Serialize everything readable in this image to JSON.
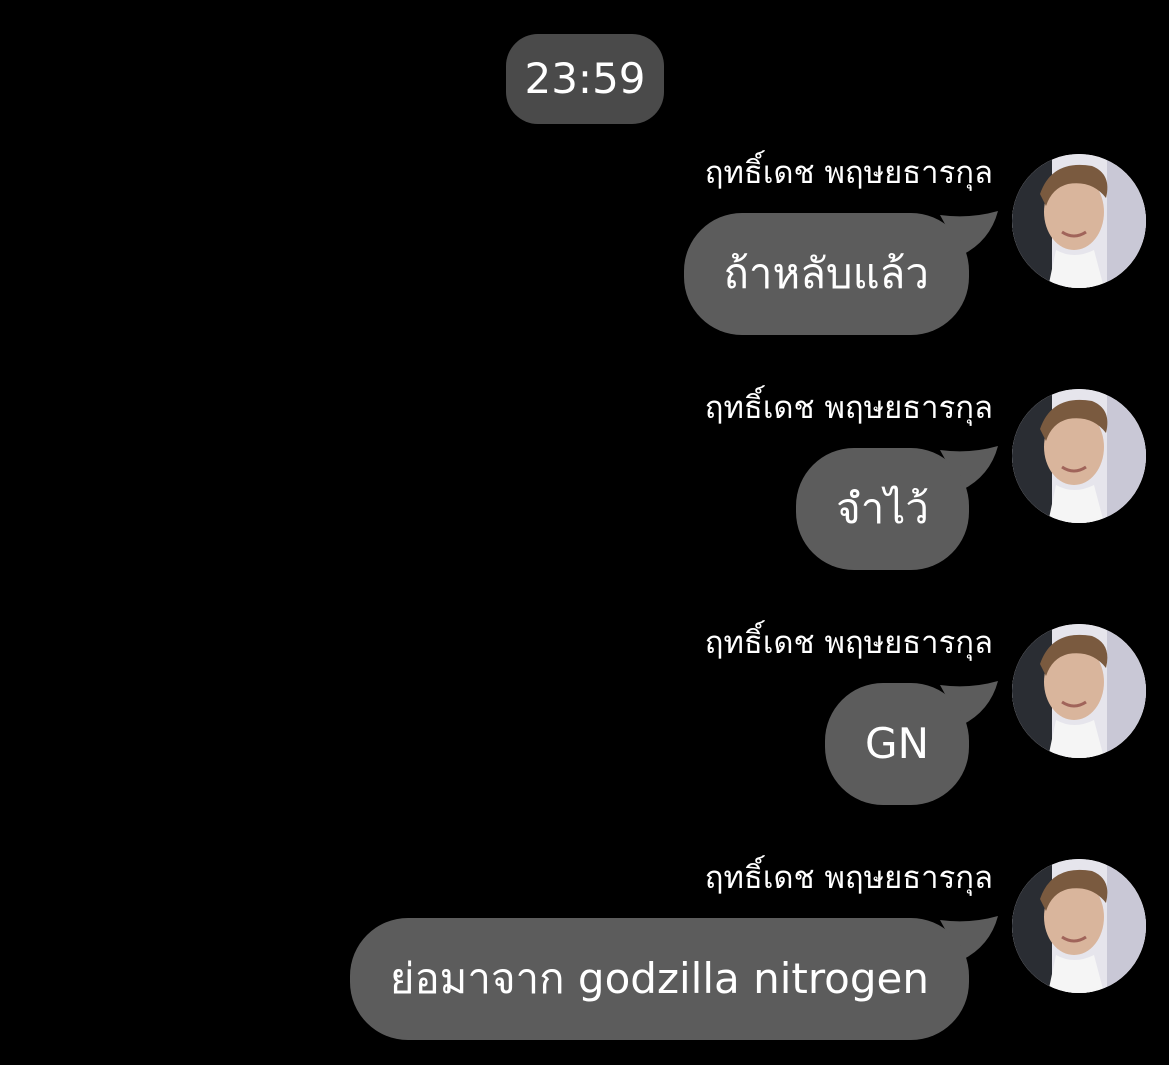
{
  "chat": {
    "timestamp": "23:59",
    "messages": [
      {
        "sender": "ฤทธิ์เดช พฤษยธารกุล",
        "text": "ถ้าหลับแล้ว"
      },
      {
        "sender": "ฤทธิ์เดช พฤษยธารกุล",
        "text": "จำไว้"
      },
      {
        "sender": "ฤทธิ์เดช พฤษยธารกุล",
        "text": "GN"
      },
      {
        "sender": "ฤทธิ์เดช พฤษยธารกุล",
        "text": "ย่อมาจาก godzilla nitrogen"
      }
    ]
  },
  "colors": {
    "background": "#000000",
    "bubble": "#5c5c5c",
    "time_pill": "#4a4a4a",
    "text": "#ffffff"
  },
  "icons": {
    "avatar": "user-avatar-photo"
  }
}
